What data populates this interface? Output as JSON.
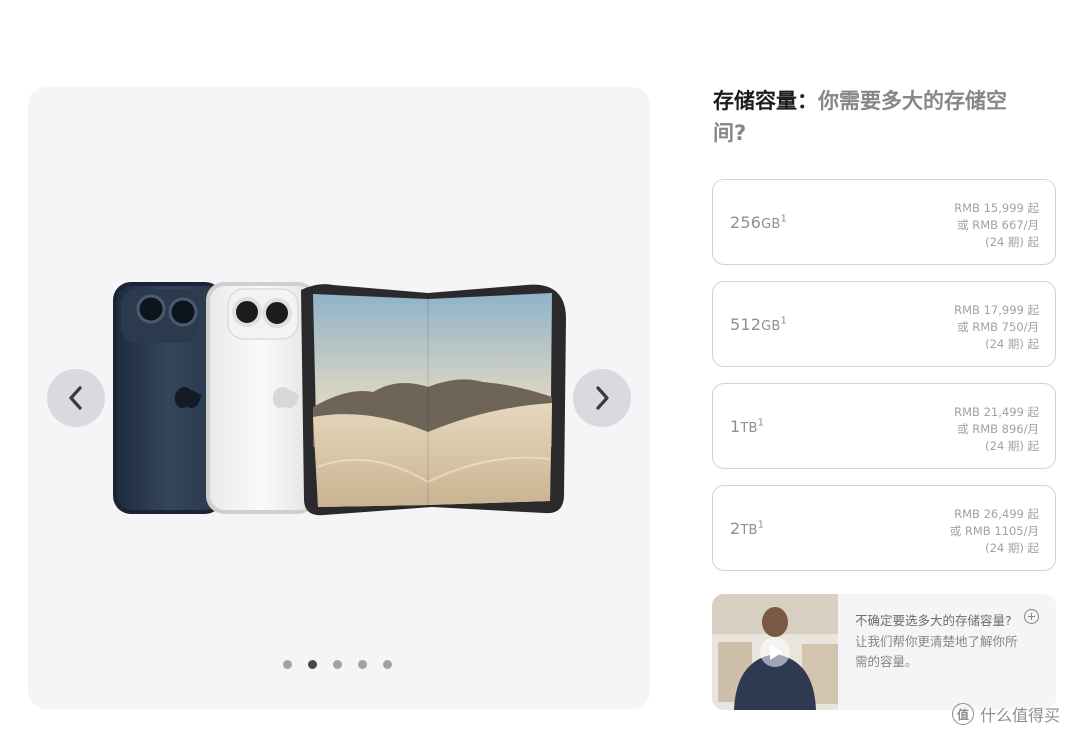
{
  "gallery": {
    "slide_count": 5,
    "active_slide": 2,
    "product_icon": "apple-logo-icon",
    "prev_icon": "chevron-left-icon",
    "next_icon": "chevron-right-icon"
  },
  "storage": {
    "heading_strong": "存储容量：",
    "heading_soft": "你需要多大的存储空间?",
    "options": [
      {
        "size": "256",
        "unit": "GB",
        "footnote": "1",
        "price": "RMB 15,999 起",
        "monthly": "或 RMB 667/月",
        "term": "(24 期) 起"
      },
      {
        "size": "512",
        "unit": "GB",
        "footnote": "1",
        "price": "RMB 17,999 起",
        "monthly": "或 RMB 750/月",
        "term": "(24 期) 起"
      },
      {
        "size": "1",
        "unit": "TB",
        "footnote": "1",
        "price": "RMB 21,499 起",
        "monthly": "或 RMB 896/月",
        "term": "(24 期) 起"
      },
      {
        "size": "2",
        "unit": "TB",
        "footnote": "1",
        "price": "RMB 26,499 起",
        "monthly": "或 RMB 1105/月",
        "term": "(24 期) 起"
      }
    ]
  },
  "help": {
    "question": "不确定要选多大的存储容量?",
    "description": "让我们帮你更清楚地了解你所需的容量。",
    "icon": "plus-circle-icon",
    "video_icon": "play-icon"
  },
  "watermark": {
    "text": "什么值得买",
    "icon_glyph": "值"
  },
  "colors": {
    "gallery_bg": "#f5f5f7",
    "border": "#d2d2d7",
    "muted_text": "#86868b",
    "dot_active": "#48484d"
  }
}
